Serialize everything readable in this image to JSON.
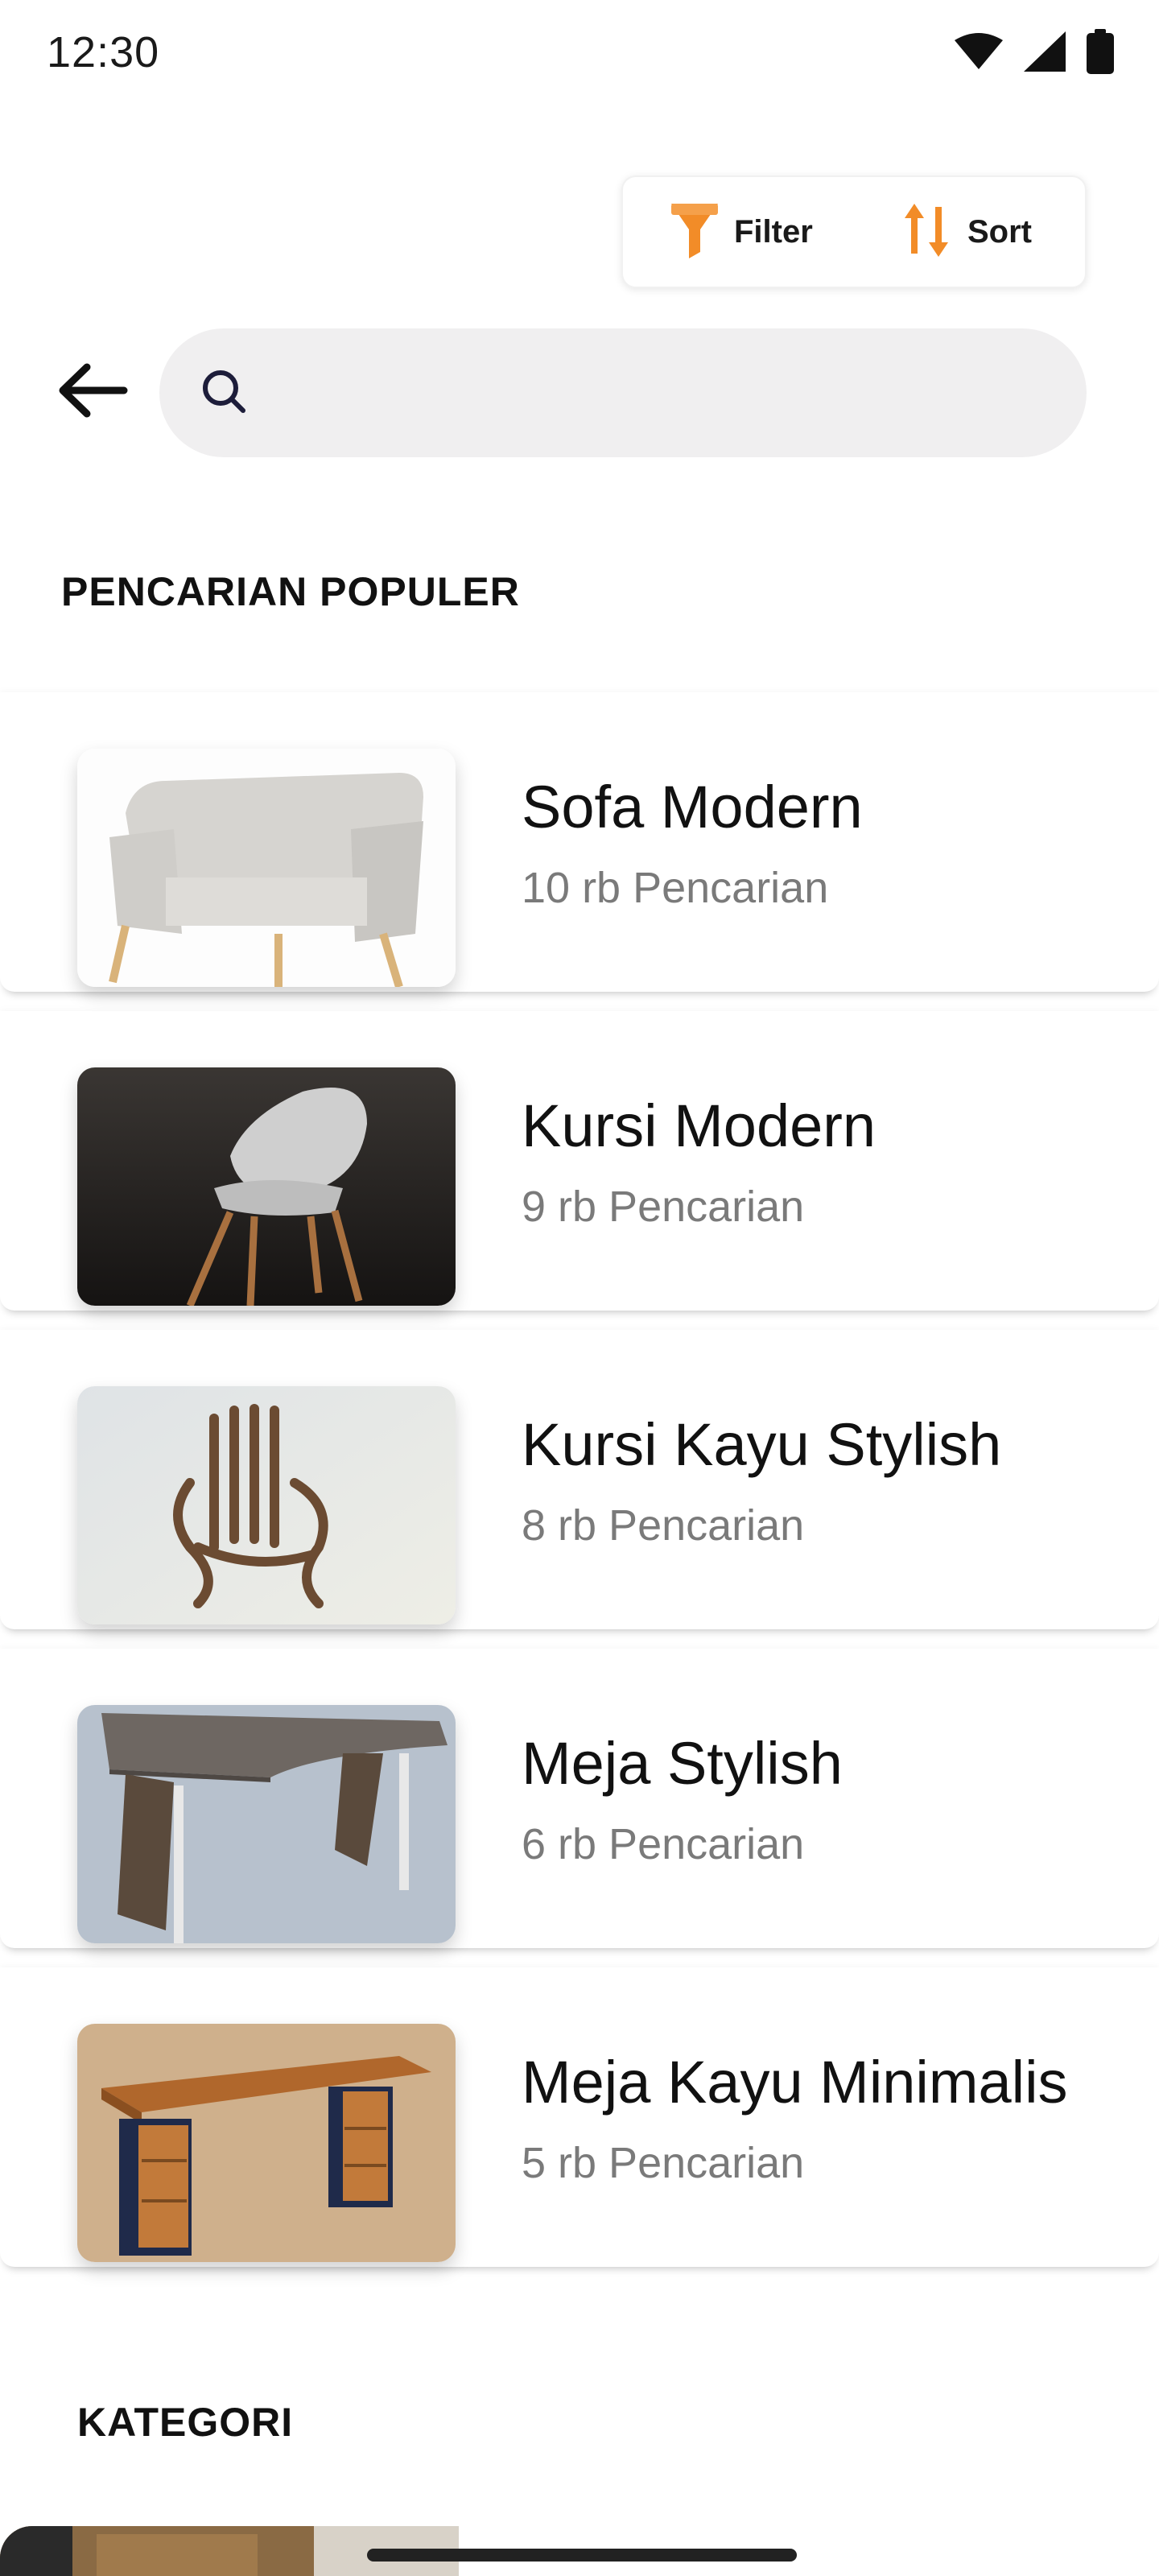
{
  "status_bar": {
    "time": "12:30",
    "icons": [
      "wifi-icon",
      "cellular-signal-icon",
      "battery-icon"
    ]
  },
  "toolbar": {
    "filter_label": "Filter",
    "sort_label": "Sort",
    "accent_color": "#f28c28"
  },
  "search": {
    "placeholder": "",
    "value": ""
  },
  "popular": {
    "title": "PENCARIAN POPULER",
    "items": [
      {
        "name": "Sofa Modern",
        "count": "10 rb Pencarian",
        "image": "sofa-image"
      },
      {
        "name": "Kursi Modern",
        "count": "9 rb Pencarian",
        "image": "modern-chair-image"
      },
      {
        "name": "Kursi Kayu Stylish",
        "count": "8 rb Pencarian",
        "image": "wood-chair-image"
      },
      {
        "name": "Meja Stylish",
        "count": "6 rb Pencarian",
        "image": "stylish-desk-image"
      },
      {
        "name": "Meja Kayu Minimalis",
        "count": "5 rb Pencarian",
        "image": "wood-desk-image"
      }
    ]
  },
  "category": {
    "title": "KATEGORI"
  }
}
